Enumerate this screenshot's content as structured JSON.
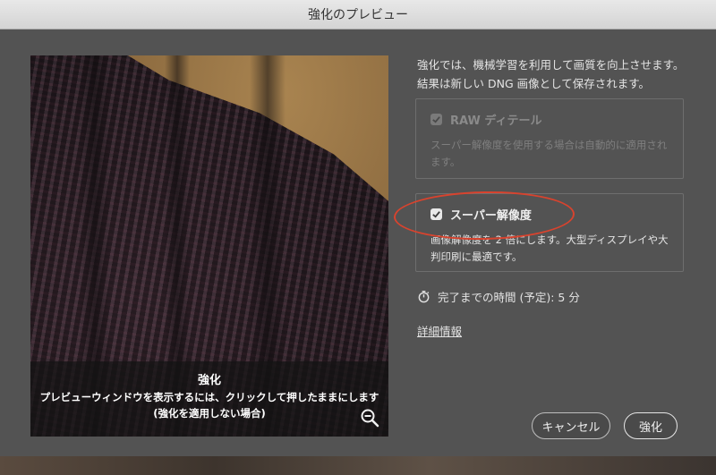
{
  "window": {
    "title": "強化のプレビュー"
  },
  "preview": {
    "overlay_title": "強化",
    "overlay_line1": "プレビューウィンドウを表示するには、クリックして押したままにします",
    "overlay_line2": "(強化を適用しない場合)",
    "zoom_icon": "zoom-out-icon"
  },
  "description": "強化では、機械学習を利用して画質を向上させます。結果は新しい DNG 画像として保存されます。",
  "options": {
    "raw_details": {
      "label": "RAW ディテール",
      "checked": true,
      "disabled": true,
      "sub": "スーパー解像度を使用する場合は自動的に適用されます。"
    },
    "super_resolution": {
      "label": "スーパー解像度",
      "checked": true,
      "disabled": false,
      "sub": "画像解像度を 2 倍にします。大型ディスプレイや大判印刷に最適です。"
    }
  },
  "estimate": {
    "icon": "stopwatch-icon",
    "text": "完了までの時間 (予定): 5 分"
  },
  "details_link": "詳細情報",
  "buttons": {
    "cancel": "キャンセル",
    "enhance": "強化"
  },
  "colors": {
    "annotation": "#d8432e",
    "dialog_bg": "#535353"
  }
}
